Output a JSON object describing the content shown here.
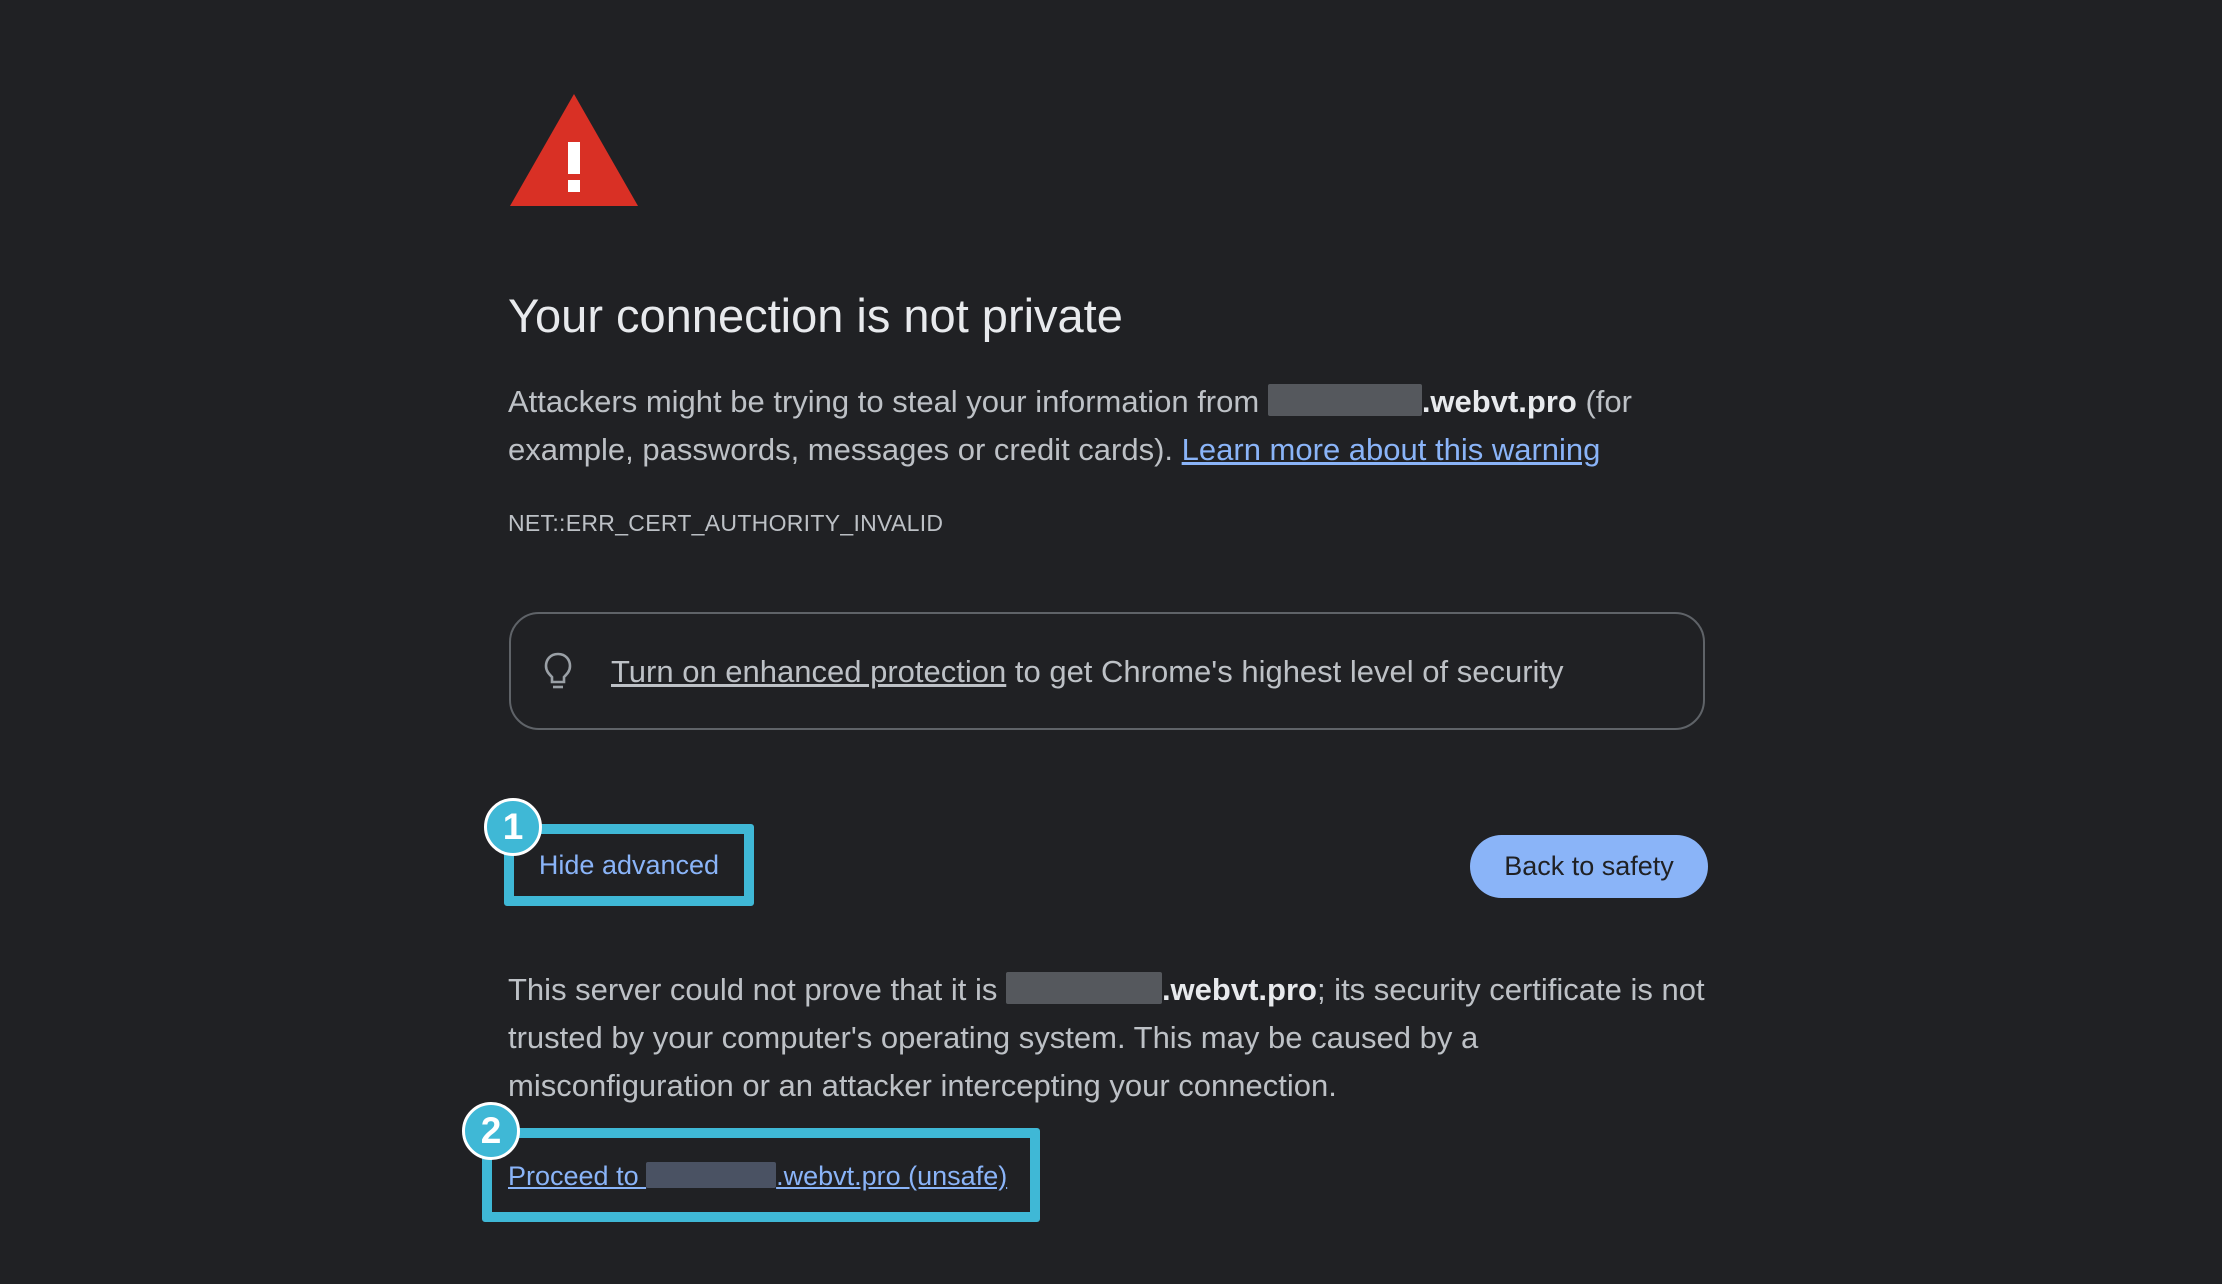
{
  "colors": {
    "background": "#202124",
    "warning_red": "#d93025",
    "link_blue": "#8ab4f8",
    "annotation_cyan": "#3fb8d6",
    "button_blue": "#8ab4f8"
  },
  "icons": {
    "warning": "warning-triangle-icon",
    "bulb": "lightbulb-icon"
  },
  "heading": {
    "title": "Your connection is not private"
  },
  "intro": {
    "before_host": "Attackers might be trying to steal your information from ",
    "host_suffix": ".webvt.pro",
    "after_host": " (for example, passwords, messages or credit cards). ",
    "learn_more_link": "Learn more about this warning"
  },
  "error_code": "NET::ERR_CERT_AUTHORITY_INVALID",
  "enhanced_protection": {
    "link": "Turn on enhanced protection",
    "rest": " to get Chrome's highest level of security"
  },
  "buttons": {
    "hide_advanced": "Hide advanced",
    "back_to_safety": "Back to safety"
  },
  "annotations": {
    "badge_1": "1",
    "badge_2": "2"
  },
  "advanced": {
    "before_host": "This server could not prove that it is ",
    "host_suffix": ".webvt.pro",
    "after_host": "; its security certificate is not trusted by your computer's operating system. This may be caused by a misconfiguration or an attacker intercepting your connection."
  },
  "proceed": {
    "prefix": "Proceed to ",
    "suffix": ".webvt.pro (unsafe)"
  }
}
